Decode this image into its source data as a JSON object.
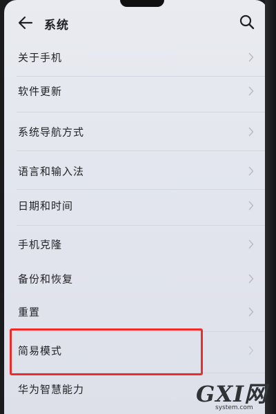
{
  "header": {
    "title": "系统",
    "back_icon": "back-arrow-icon",
    "search_icon": "search-icon"
  },
  "menu": {
    "items": [
      {
        "label": "关于手机"
      },
      {
        "label": "软件更新"
      },
      {
        "label": "系统导航方式"
      },
      {
        "label": "语言和输入法"
      },
      {
        "label": "日期和时间"
      },
      {
        "label": "手机克隆"
      },
      {
        "label": "备份和恢复"
      },
      {
        "label": "重置"
      },
      {
        "label": "简易模式",
        "highlighted": true
      },
      {
        "label": "华为智慧能力"
      }
    ]
  },
  "annotation": {
    "highlight_color": "#ec2b2b",
    "highlighted_item": "简易模式"
  },
  "watermark": {
    "main": "GXI网",
    "sub": "system.com"
  },
  "colors": {
    "background": "#e6e8ee",
    "text": "#222327",
    "chevron": "#b9bcc4",
    "highlight": "#ec2b2b"
  }
}
